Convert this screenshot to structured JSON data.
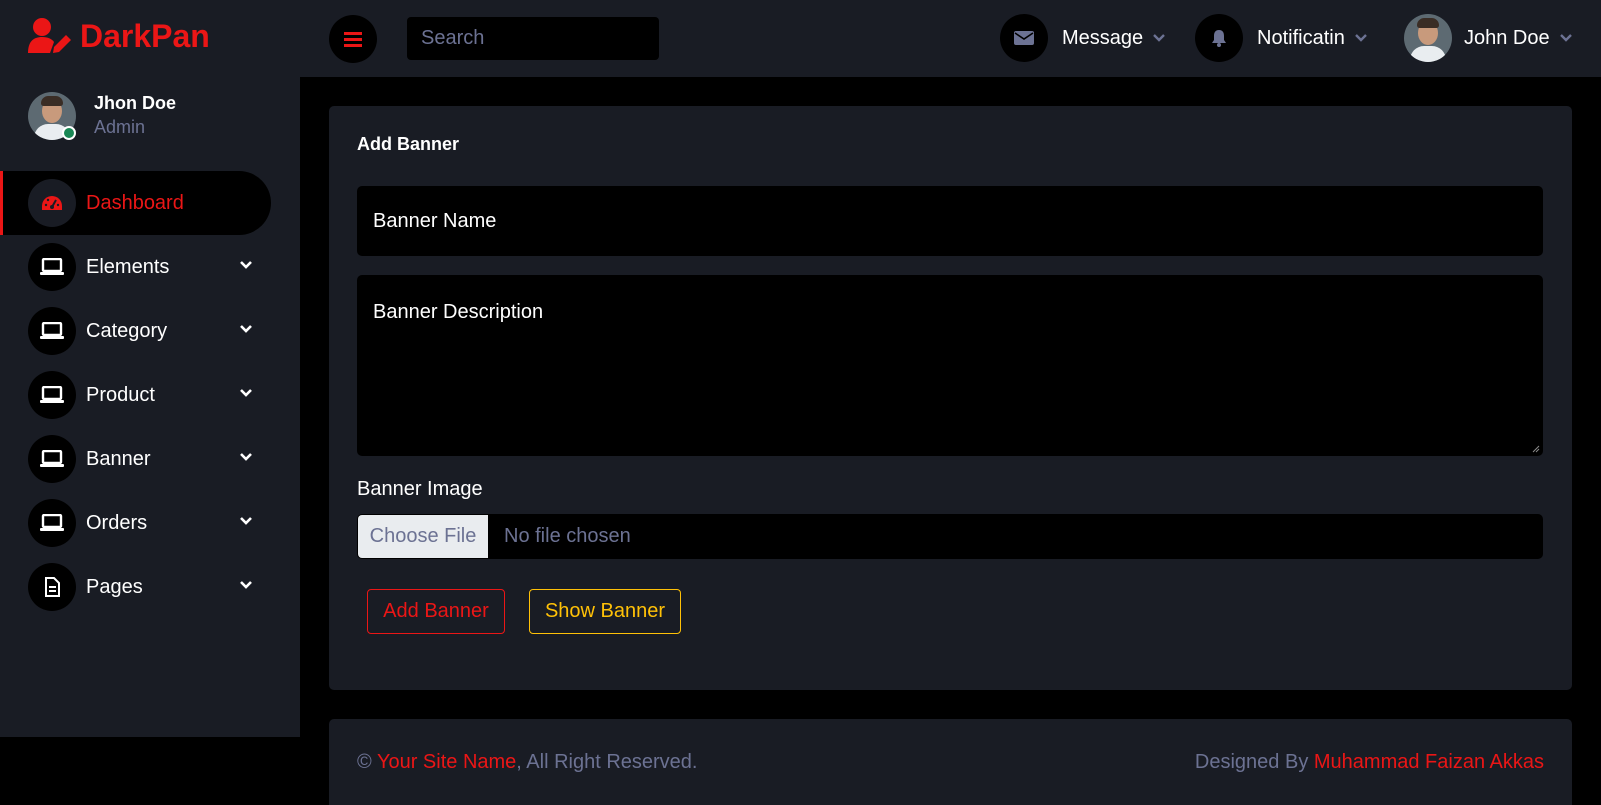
{
  "brand": {
    "name": "DarkPan",
    "icon": "user-edit-icon"
  },
  "colors": {
    "primary": "#eb1616",
    "secondary": "#191c24",
    "warning": "#ffc107",
    "muted": "#6c7293",
    "online": "#198754"
  },
  "sidebar": {
    "profile": {
      "name": "Jhon Doe",
      "role": "Admin"
    },
    "items": [
      {
        "label": "Dashboard",
        "icon": "tachometer-icon",
        "active": true
      },
      {
        "label": "Elements",
        "icon": "laptop-icon"
      },
      {
        "label": "Category",
        "icon": "laptop-icon"
      },
      {
        "label": "Product",
        "icon": "laptop-icon"
      },
      {
        "label": "Banner",
        "icon": "laptop-icon"
      },
      {
        "label": "Orders",
        "icon": "laptop-icon"
      },
      {
        "label": "Pages",
        "icon": "file-icon"
      }
    ]
  },
  "topbar": {
    "search_placeholder": "Search",
    "message_label": "Message",
    "notification_label": "Notificatin",
    "user_name": "John Doe"
  },
  "form": {
    "title": "Add Banner",
    "name_placeholder": "Banner Name",
    "description_placeholder": "Banner Description",
    "image_label": "Banner Image",
    "choose_file_label": "Choose File",
    "file_status": "No file chosen",
    "add_button": "Add Banner",
    "show_button": "Show Banner"
  },
  "footer": {
    "copyright_symbol": "©",
    "site_name": "Your Site Name",
    "rights_text": ", All Right Reserved.",
    "designed_by_text": "Designed By ",
    "designer_name": "Muhammad Faizan Akkas"
  }
}
